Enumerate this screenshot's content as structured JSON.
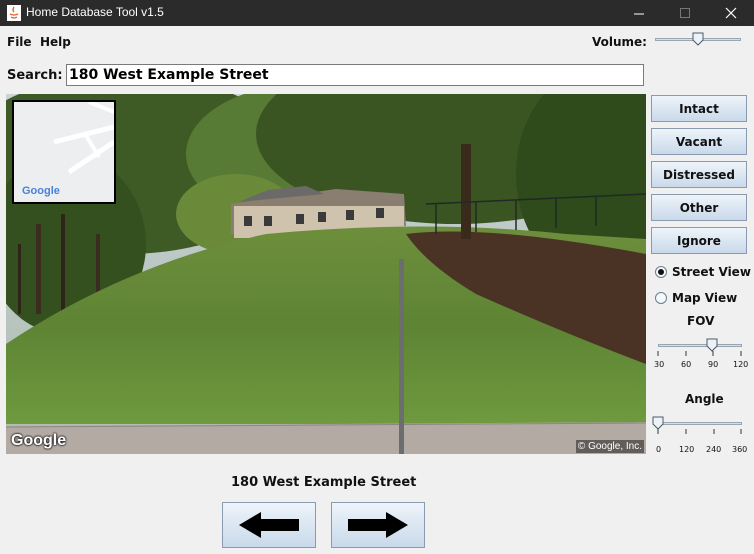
{
  "window": {
    "title": "Home Database Tool v1.5"
  },
  "menu": {
    "file": "File",
    "help": "Help"
  },
  "volume": {
    "label": "Volume:",
    "level_percent": 50
  },
  "search": {
    "label": "Search:",
    "value": "180 West Example Street"
  },
  "photo": {
    "watermark_logo": "Google",
    "minimap_logo": "Google",
    "copyright": "© Google, Inc."
  },
  "buttons": {
    "intact": "Intact",
    "vacant": "Vacant",
    "distressed": "Distressed",
    "other": "Other",
    "ignore": "Ignore"
  },
  "view_mode": {
    "street": "Street View",
    "map": "Map View",
    "selected": "street"
  },
  "fov": {
    "label": "FOV",
    "ticks": [
      "30",
      "60",
      "90",
      "120"
    ],
    "value": 90
  },
  "angle": {
    "label": "Angle",
    "ticks": [
      "0",
      "120",
      "240",
      "360"
    ],
    "value": 0
  },
  "address_caption": "180 West Example Street",
  "nav": {
    "prev_icon": "arrow-left-icon",
    "next_icon": "arrow-right-icon"
  },
  "colors": {
    "titlebar": "#2b2b2b",
    "button_top": "#eef4fa",
    "button_bottom": "#c9d9ea"
  }
}
